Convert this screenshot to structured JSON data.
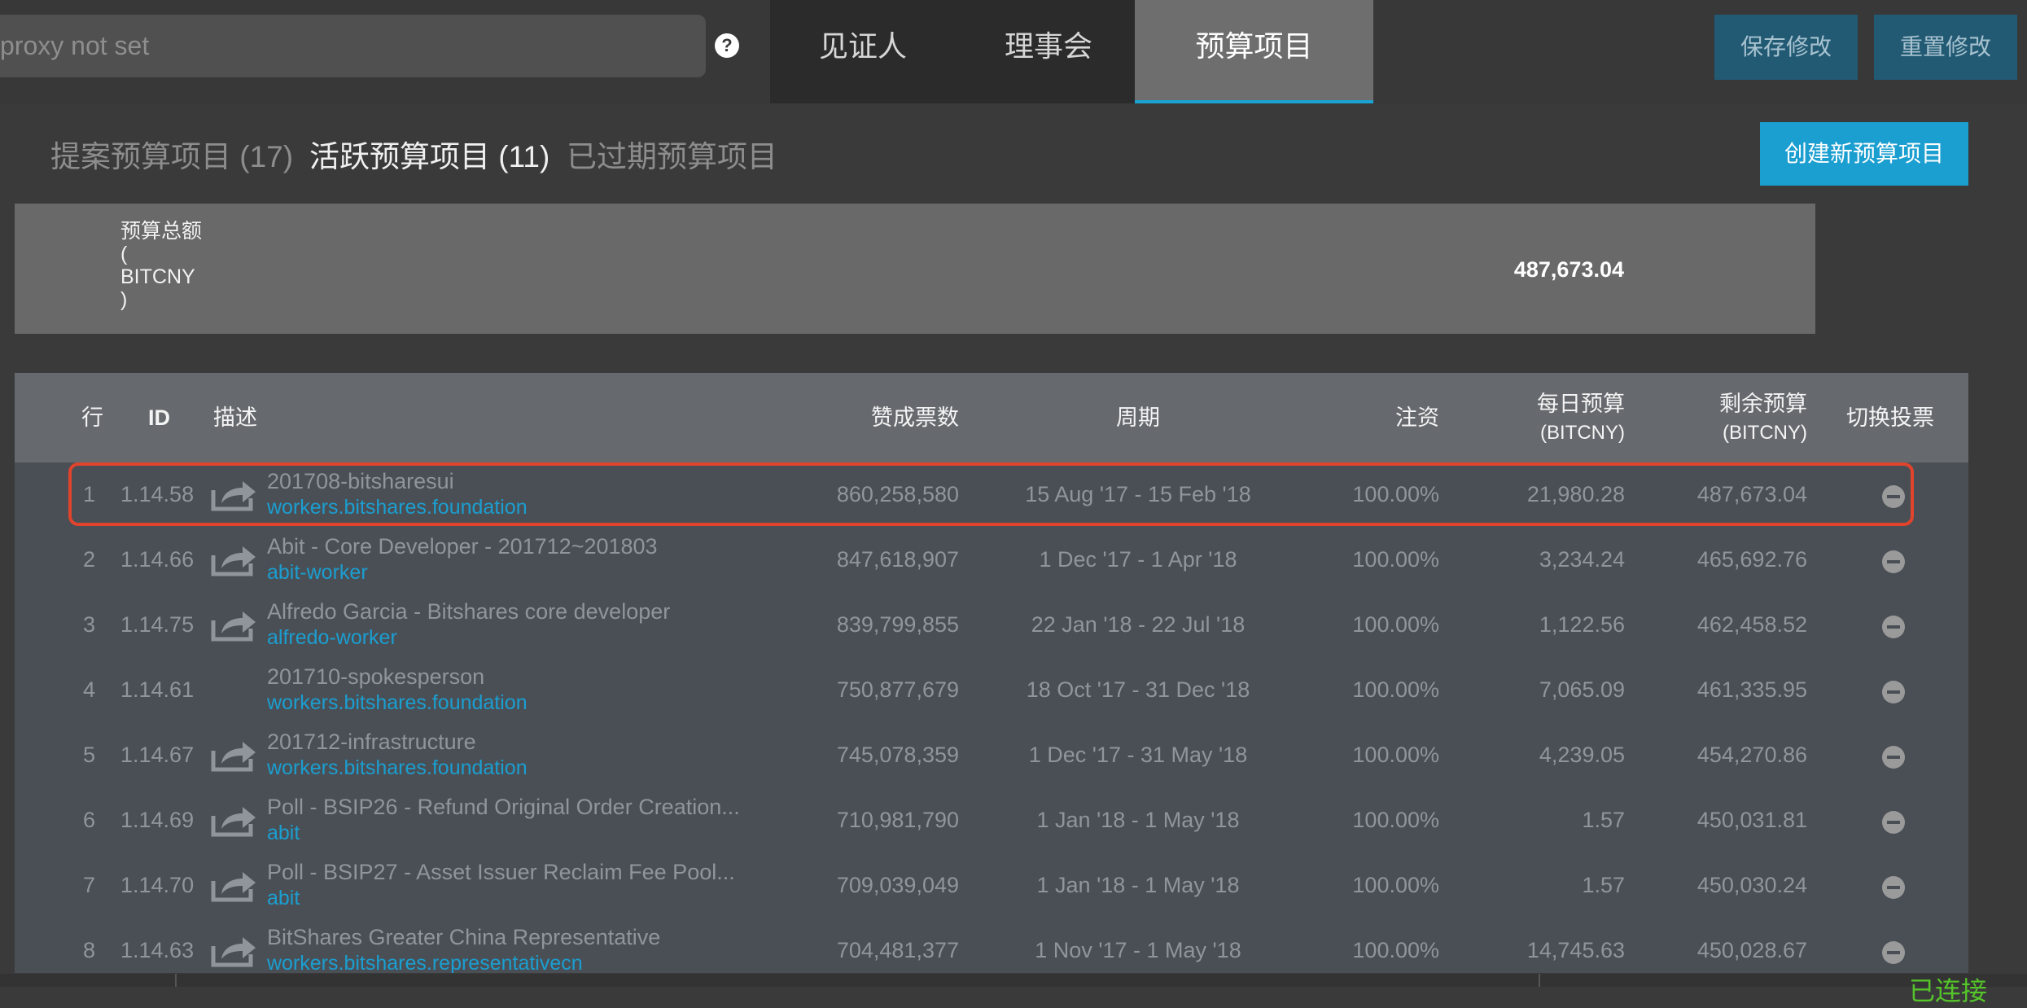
{
  "header": {
    "proxy_text": "proxy not set",
    "help_icon": "?",
    "tabs": [
      "见证人",
      "理事会",
      "预算项目"
    ],
    "save_label": "保存修改",
    "reset_label": "重置修改"
  },
  "subtabs": {
    "proposed": "提案预算项目 (17)",
    "active": "活跃预算项目 (11)",
    "expired": "已过期预算项目",
    "create_label": "创建新预算项目"
  },
  "total": {
    "label": "预算总额 ( BITCNY )",
    "value": "487,673.04"
  },
  "table": {
    "headers": {
      "row": "行",
      "id": "ID",
      "desc": "描述",
      "votes": "赞成票数",
      "period": "周期",
      "pay": "注资",
      "daily": "每日预算",
      "daily_unit": "(BITCNY)",
      "remain": "剩余预算",
      "remain_unit": "(BITCNY)",
      "toggle": "切换投票"
    },
    "rows": [
      {
        "n": "1",
        "id": "1.14.58",
        "title": "201708-bitsharesui",
        "link": "workers.bitshares.foundation",
        "votes": "860,258,580",
        "period": "15 Aug '17 - 15 Feb '18",
        "pay": "100.00%",
        "daily": "21,980.28",
        "remain": "487,673.04",
        "icon": true
      },
      {
        "n": "2",
        "id": "1.14.66",
        "title": "Abit - Core Developer - 201712~201803",
        "link": "abit-worker",
        "votes": "847,618,907",
        "period": "1 Dec '17 - 1 Apr '18",
        "pay": "100.00%",
        "daily": "3,234.24",
        "remain": "465,692.76",
        "icon": true
      },
      {
        "n": "3",
        "id": "1.14.75",
        "title": "Alfredo Garcia - Bitshares core developer",
        "link": "alfredo-worker",
        "votes": "839,799,855",
        "period": "22 Jan '18 - 22 Jul '18",
        "pay": "100.00%",
        "daily": "1,122.56",
        "remain": "462,458.52",
        "icon": true
      },
      {
        "n": "4",
        "id": "1.14.61",
        "title": "201710-spokesperson",
        "link": "workers.bitshares.foundation",
        "votes": "750,877,679",
        "period": "18 Oct '17 - 31 Dec '18",
        "pay": "100.00%",
        "daily": "7,065.09",
        "remain": "461,335.95",
        "icon": false
      },
      {
        "n": "5",
        "id": "1.14.67",
        "title": "201712-infrastructure",
        "link": "workers.bitshares.foundation",
        "votes": "745,078,359",
        "period": "1 Dec '17 - 31 May '18",
        "pay": "100.00%",
        "daily": "4,239.05",
        "remain": "454,270.86",
        "icon": true
      },
      {
        "n": "6",
        "id": "1.14.69",
        "title": "Poll - BSIP26 - Refund Original Order Creation...",
        "link": "abit",
        "votes": "710,981,790",
        "period": "1 Jan '18 - 1 May '18",
        "pay": "100.00%",
        "daily": "1.57",
        "remain": "450,031.81",
        "icon": true
      },
      {
        "n": "7",
        "id": "1.14.70",
        "title": "Poll - BSIP27 - Asset Issuer Reclaim Fee Pool...",
        "link": "abit",
        "votes": "709,039,049",
        "period": "1 Jan '18 - 1 May '18",
        "pay": "100.00%",
        "daily": "1.57",
        "remain": "450,030.24",
        "icon": true
      },
      {
        "n": "8",
        "id": "1.14.63",
        "title": "BitShares Greater China Representative",
        "link": "workers.bitshares.representativecn",
        "votes": "704,481,377",
        "period": "1 Nov '17 - 1 May '18",
        "pay": "100.00%",
        "daily": "14,745.63",
        "remain": "450,028.67",
        "icon": true
      }
    ]
  },
  "status": {
    "text": "已连接"
  }
}
